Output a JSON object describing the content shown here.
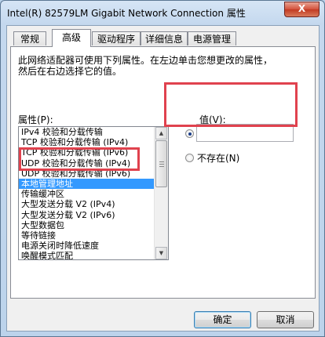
{
  "window": {
    "title": "Intel(R) 82579LM Gigabit Network Connection 属性",
    "close_label": "X"
  },
  "tabs": [
    {
      "label": "常规",
      "active": false
    },
    {
      "label": "高级",
      "active": true
    },
    {
      "label": "驱动程序",
      "active": false
    },
    {
      "label": "详细信息",
      "active": false
    },
    {
      "label": "电源管理",
      "active": false
    }
  ],
  "panel": {
    "description_line1": "此网络适配器可使用下列属性。在左边单击您想更改的属性，",
    "description_line2": "然后在右边选择它的值。",
    "properties_label": "属性(P):",
    "value_label": "值(V):",
    "value_input": "",
    "not_exist_label": "不存在(N)",
    "value_radio_checked": true
  },
  "properties": [
    "IPv4 校验和分载传输",
    "TCP 校验和分载传输 (IPv4)",
    "TCP 校验和分载传输 (IPv6)",
    "UDP 校验和分载传输 (IPv4)",
    "UDP 校验和分载传输 (IPv6)",
    "本地管理地址",
    "传输缓冲区",
    "大型发送分载 V2 (IPv4)",
    "大型发送分载 V2 (IPv6)",
    "大型数据包",
    "等待链接",
    "电源关闭时降低速度",
    "唤醒模式匹配",
    "唤醒魔包"
  ],
  "selected_property_index": 5,
  "buttons": {
    "ok": "确定",
    "cancel": "取消"
  },
  "colors": {
    "selection": "#3399ff",
    "annotation": "#e0424e"
  }
}
